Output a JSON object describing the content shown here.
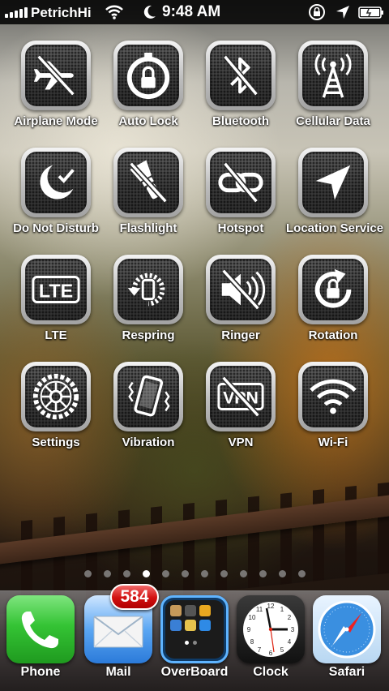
{
  "status_bar": {
    "carrier": "PetrichHi",
    "time": "9:48 AM",
    "icons": [
      "signal-bars-icon",
      "wifi-icon",
      "do-not-disturb-moon-icon",
      "rotation-lock-icon",
      "location-arrow-icon",
      "battery-charging-icon"
    ]
  },
  "toggles": [
    {
      "label": "Airplane Mode",
      "icon": "airplane-icon"
    },
    {
      "label": "Auto Lock",
      "icon": "auto-lock-icon"
    },
    {
      "label": "Bluetooth",
      "icon": "bluetooth-icon"
    },
    {
      "label": "Cellular Data",
      "icon": "cellular-tower-icon"
    },
    {
      "label": "Do Not Disturb",
      "icon": "moon-icon"
    },
    {
      "label": "Flashlight",
      "icon": "flashlight-icon"
    },
    {
      "label": "Hotspot",
      "icon": "hotspot-link-icon"
    },
    {
      "label": "Location Service",
      "icon": "location-arrow-icon"
    },
    {
      "label": "LTE",
      "icon": "lte-icon"
    },
    {
      "label": "Respring",
      "icon": "respring-icon"
    },
    {
      "label": "Ringer",
      "icon": "speaker-icon"
    },
    {
      "label": "Rotation",
      "icon": "rotation-lock-icon"
    },
    {
      "label": "Settings",
      "icon": "gear-icon"
    },
    {
      "label": "Vibration",
      "icon": "vibration-phone-icon"
    },
    {
      "label": "VPN",
      "icon": "vpn-icon"
    },
    {
      "label": "Wi-Fi",
      "icon": "wifi-icon"
    }
  ],
  "page_dots": {
    "count": 12,
    "active_index": 3
  },
  "dock": [
    {
      "label": "Phone",
      "icon": "phone-app-icon"
    },
    {
      "label": "Mail",
      "icon": "mail-app-icon",
      "badge": "584"
    },
    {
      "label": "OverBoard",
      "icon": "overboard-folder-icon"
    },
    {
      "label": "Clock",
      "icon": "clock-app-icon"
    },
    {
      "label": "Safari",
      "icon": "safari-app-icon"
    }
  ],
  "colors": {
    "badge_red": "#d10f0f",
    "phone_green": "#2fb52f",
    "safari_blue": "#3a8fe0"
  }
}
